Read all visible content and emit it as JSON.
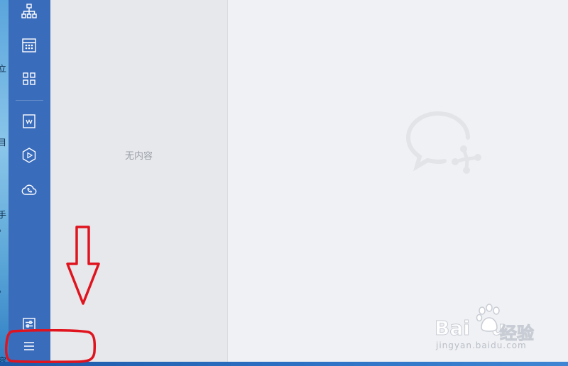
{
  "desktop": {
    "edge_glyphs": [
      "立",
      "目",
      "手",
      "。",
      "。",
      "容"
    ]
  },
  "sidebar": {
    "items": [
      {
        "name": "org-chart-icon"
      },
      {
        "name": "calendar-icon"
      },
      {
        "name": "apps-grid-icon"
      },
      {
        "name": "document-icon"
      },
      {
        "name": "drive-icon"
      },
      {
        "name": "cloud-phone-icon"
      },
      {
        "name": "settings-sliders-icon"
      },
      {
        "name": "menu-icon"
      }
    ]
  },
  "list_pane": {
    "empty_text": "无内容"
  },
  "content_pane": {
    "logo": "wechat-work-logo"
  },
  "annotations": {
    "color": "#e0141e",
    "arrow_direction": "down"
  },
  "watermark": {
    "brand": "Bai",
    "brand_suffix": "u",
    "cn": "经验",
    "url": "jingyan.baidu.com"
  },
  "colors": {
    "sidebar": "#3a6cbc",
    "list_pane": "#e6e8ec",
    "content_pane": "#f0f1f4"
  }
}
